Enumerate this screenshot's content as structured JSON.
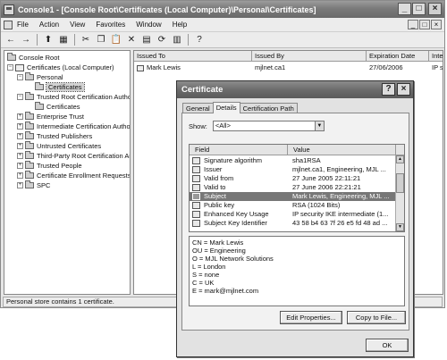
{
  "window": {
    "title": "Console1 - [Console Root\\Certificates (Local Computer)\\Personal\\Certificates]",
    "min": "_",
    "max": "□",
    "close": "×"
  },
  "menubar": {
    "items": [
      "File",
      "Action",
      "View",
      "Favorites",
      "Window",
      "Help"
    ],
    "mdi_min": "_",
    "mdi_max": "□",
    "mdi_close": "×"
  },
  "toolbar": {
    "back_icon": "←",
    "forward_icon": "→",
    "up_icon": "⬆",
    "show_hide_icon": "▦",
    "cut_icon": "✂",
    "copy_icon": "❐",
    "paste_icon": "📋",
    "delete_icon": "✕",
    "properties_icon": "▤",
    "refresh_icon": "⟳",
    "export_icon": "▥",
    "help_icon": "?"
  },
  "tree": {
    "nodes": [
      {
        "label": "Console Root"
      },
      {
        "label": "Certificates (Local Computer)"
      },
      {
        "label": "Personal"
      },
      {
        "label": "Certificates"
      },
      {
        "label": "Trusted Root Certification Author"
      },
      {
        "label": "Certificates"
      },
      {
        "label": "Enterprise Trust"
      },
      {
        "label": "Intermediate Certification Author"
      },
      {
        "label": "Trusted Publishers"
      },
      {
        "label": "Untrusted Certificates"
      },
      {
        "label": "Third-Party Root Certification Au"
      },
      {
        "label": "Trusted People"
      },
      {
        "label": "Certificate Enrollment Requests"
      },
      {
        "label": "SPC"
      }
    ],
    "expand": "+",
    "collapse": "−"
  },
  "list": {
    "columns": [
      "Issued To",
      "Issued By",
      "Expiration Date",
      "Intende"
    ],
    "rows": [
      {
        "issued_to": "Mark Lewis",
        "issued_by": "mjlnet.ca1",
        "expiration": "27/06/2006",
        "intended": "IP sec"
      }
    ]
  },
  "status": {
    "text": "Personal store contains 1 certificate."
  },
  "dialog": {
    "title": "Certificate",
    "help_btn": "?",
    "close_btn": "×",
    "tabs": [
      "General",
      "Details",
      "Certification Path"
    ],
    "show_label": "Show:",
    "show_value": "<All>",
    "dropdown_arrow": "▼",
    "scroll_up": "▲",
    "scroll_down": "▼",
    "field_header": "Field",
    "value_header": "Value",
    "fields": [
      {
        "field": "Signature algorithm",
        "value": "sha1RSA"
      },
      {
        "field": "Issuer",
        "value": "mjlnet.ca1, Engineering, MJL ..."
      },
      {
        "field": "Valid from",
        "value": "27 June 2005 22:11:21"
      },
      {
        "field": "Valid to",
        "value": "27 June 2006 22:21:21"
      },
      {
        "field": "Subject",
        "value": "Mark Lewis, Engineering, MJL ..."
      },
      {
        "field": "Public key",
        "value": "RSA (1024 Bits)"
      },
      {
        "field": "Enhanced Key Usage",
        "value": "IP security IKE intermediate (1..."
      },
      {
        "field": "Subject Key Identifier",
        "value": "43 58 b4 63 7f 26 e5 fd 48 ad ..."
      }
    ],
    "selected_field": "Subject",
    "detail_lines": [
      "CN = Mark Lewis",
      "OU = Engineering",
      "O = MJL Network Solutions",
      "L = London",
      "S = none",
      "C = UK",
      "E = mark@mjlnet.com"
    ],
    "edit_properties": "Edit Properties...",
    "copy_to_file": "Copy to File...",
    "ok": "OK"
  }
}
